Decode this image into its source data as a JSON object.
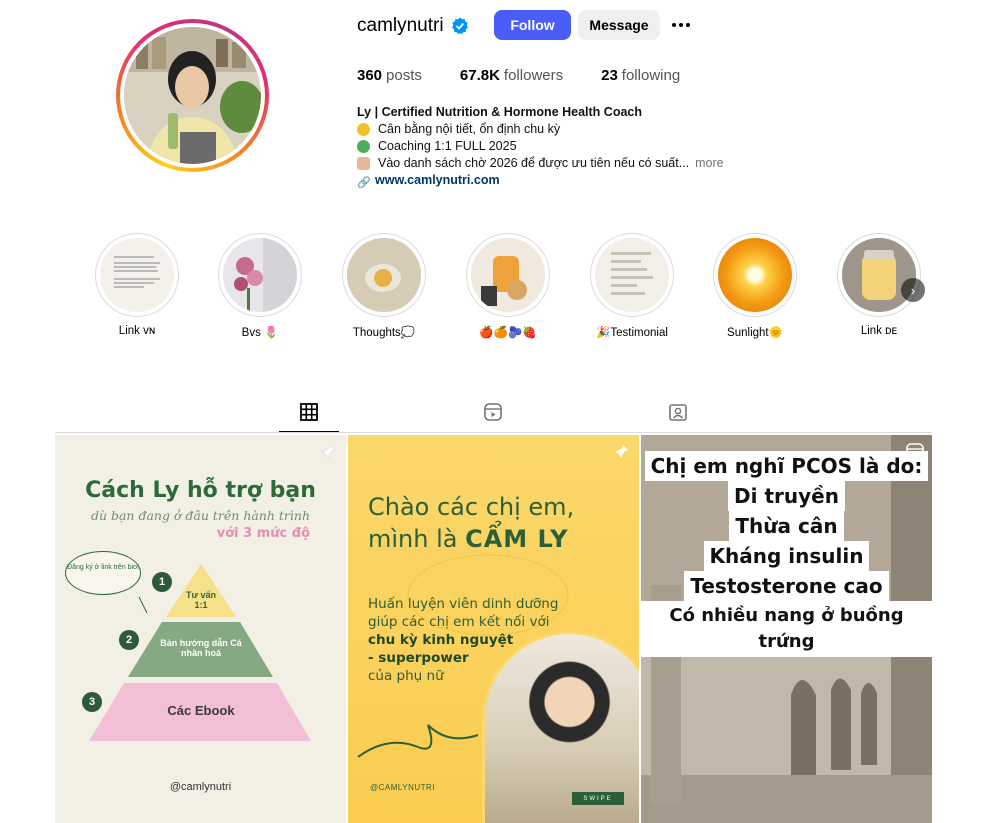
{
  "profile": {
    "username": "camlynutri",
    "follow_label": "Follow",
    "message_label": "Message",
    "stats": {
      "posts_count": "360",
      "posts_label": "posts",
      "followers_count": "67.8K",
      "followers_label": "followers",
      "following_count": "23",
      "following_label": "following"
    },
    "bio": {
      "name": "Ly | Certified Nutrition & Hormone Health Coach",
      "line1": "Cân bằng nội tiết, ổn định chu kỳ",
      "line2": "Coaching 1:1 FULL 2025",
      "line3": "Vào danh sách chờ 2026 để được ưu tiên nếu có suất...",
      "more": "more",
      "link": "www.camlynutri.com"
    }
  },
  "highlights": [
    {
      "label": "Link ᴠɴ"
    },
    {
      "label": "Bvs 🌷"
    },
    {
      "label": "Thoughts💭"
    },
    {
      "label": "🍎🍊🫐🍓"
    },
    {
      "label": "🎉Testimonial"
    },
    {
      "label": "Sunlight🌞"
    },
    {
      "label": "Link ᴅᴇ"
    }
  ],
  "tabs": [
    {
      "name": "posts",
      "icon": "grid-icon"
    },
    {
      "name": "reels",
      "icon": "reels-icon"
    },
    {
      "name": "tagged",
      "icon": "tagged-icon"
    }
  ],
  "posts": {
    "post1": {
      "title": "Cách Ly hỗ trợ bạn",
      "subtitle": "dù bạn đang ở đâu trên hành trình",
      "subtitle2": "với 3 mức độ",
      "bubble": "Đăng ký ở link trên bio!",
      "level1": "Tư vấn 1:1",
      "level2": "Bản hướng dẫn Cá nhân hoá",
      "level3": "Các Ebook",
      "n1": "1",
      "n2": "2",
      "n3": "3",
      "handle": "@camlynutri"
    },
    "post2": {
      "hello1": "Chào các chị em,",
      "hello2": "mình là ",
      "hello_name": "CẨM LY",
      "body1": "Huấn luyện viên dinh dưỡng",
      "body2": "giúp các chị em kết nối với",
      "body3": "chu kỳ kinh nguyệt",
      "body4": "- superpower",
      "body5": "của phụ nữ",
      "handle": "@CAMLYNUTRI",
      "swipe": "SWIPE"
    },
    "post3": {
      "lines": [
        "Chị em nghĩ PCOS là do:",
        "Di truyền",
        "Thừa cân",
        "Kháng insulin",
        "Testosterone cao",
        "Có nhiều nang ở buồng trứng"
      ]
    }
  },
  "colors": {
    "follow_blue": "#4a5df9",
    "link_blue": "#00376b",
    "brand_green": "#2d6a3a",
    "post2_yellow": "#fbd86b"
  }
}
